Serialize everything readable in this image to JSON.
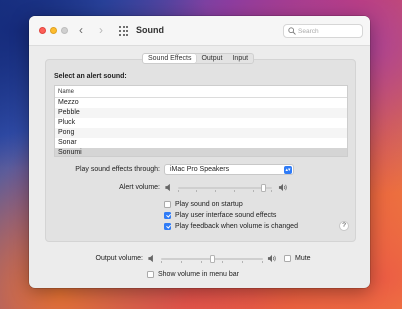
{
  "window": {
    "title": "Sound",
    "search_placeholder": "Search",
    "icons": [
      "back-chevron-icon",
      "forward-chevron-icon",
      "show-all-grid-icon",
      "search-icon"
    ]
  },
  "tabs": [
    {
      "label": "Sound Effects",
      "active": true
    },
    {
      "label": "Output",
      "active": false
    },
    {
      "label": "Input",
      "active": false
    }
  ],
  "sound_effects": {
    "heading": "Select an alert sound:",
    "list_header": "Name",
    "sounds": [
      "Mezzo",
      "Pebble",
      "Pluck",
      "Pong",
      "Sonar",
      "Sonumi"
    ],
    "selected": "Sonumi",
    "play_through_label": "Play sound effects through:",
    "play_through_value": "iMac Pro Speakers",
    "alert_volume_label": "Alert volume:",
    "alert_volume_level": 0.93,
    "options": [
      {
        "label": "Play sound on startup",
        "checked": false
      },
      {
        "label": "Play user interface sound effects",
        "checked": true
      },
      {
        "label": "Play feedback when volume is changed",
        "checked": true
      }
    ],
    "help_label": "?"
  },
  "output": {
    "volume_label": "Output volume:",
    "volume_level": 0.5,
    "mute_label": "Mute",
    "mute_checked": false,
    "show_menu_label": "Show volume in menu bar",
    "show_menu_checked": false
  },
  "colors": {
    "accent": "#2f7bf6",
    "close": "#fe5f57",
    "minimize": "#febc2e"
  }
}
